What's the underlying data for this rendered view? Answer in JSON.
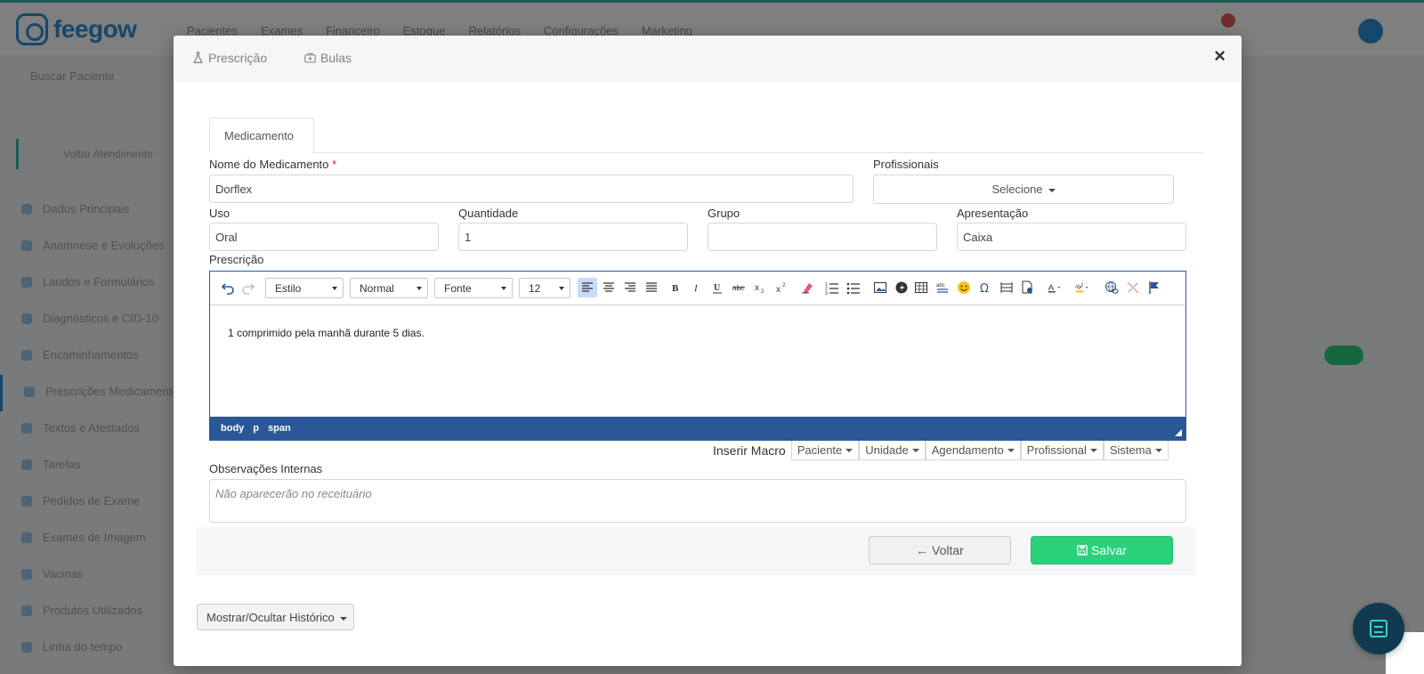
{
  "background": {
    "logo": "feegow",
    "nav": [
      "Pacientes",
      "Exames",
      "Financeiro",
      "Estoque",
      "Relatórios",
      "Configurações",
      "Marketing"
    ],
    "search_placeholder": "Buscar Paciente",
    "side_button": "Voltar Atendimento",
    "side_items": [
      "Dados Principais",
      "Anamnese e Evoluções",
      "Laudos e Formulários",
      "Diagnósticos e CID-10",
      "Encaminhamentos",
      "Prescrições Medicamentos",
      "Textos e Atestados",
      "Tarefas",
      "Pedidos de Exame",
      "Exames de Imagem",
      "Vacinas",
      "Produtos Utilizados",
      "Linha do tempo"
    ]
  },
  "modal": {
    "tabs": [
      {
        "label": "Prescrição",
        "icon": "flask-icon"
      },
      {
        "label": "Bulas",
        "icon": "medkit-icon"
      }
    ],
    "close_label": "×",
    "inner_tab": "Medicamento",
    "fields": {
      "nome_label": "Nome do Medicamento",
      "required_mark": "*",
      "nome_value": "Dorflex",
      "profissionais_label": "Profissionais",
      "profissionais_value": "Selecione",
      "uso_label": "Uso",
      "uso_value": "Oral",
      "quantidade_label": "Quantidade",
      "quantidade_value": "1",
      "grupo_label": "Grupo",
      "grupo_value": "",
      "apresentacao_label": "Apresentação",
      "apresentacao_value": "Caixa",
      "prescricao_label": "Prescrição"
    },
    "editor": {
      "combos": {
        "style": "Estilo",
        "format": "Normal",
        "font": "Fonte",
        "size": "12"
      },
      "content": "1 comprimido pela manhã durante 5 dias.",
      "path": [
        "body",
        "p",
        "span"
      ]
    },
    "macro": {
      "label": "Inserir Macro",
      "buttons": [
        "Paciente",
        "Unidade",
        "Agendamento",
        "Profissional",
        "Sistema"
      ]
    },
    "observacoes_label": "Observações Internas",
    "observacoes_placeholder": "Não aparecerão no receituário",
    "voltar_label": "Voltar",
    "salvar_label": "Salvar",
    "historico_label": "Mostrar/Ocultar Histórico"
  },
  "colors": {
    "primary_blue": "#2b5797",
    "save_green": "#2ad07a",
    "chat_bg": "#0f3a4f"
  }
}
